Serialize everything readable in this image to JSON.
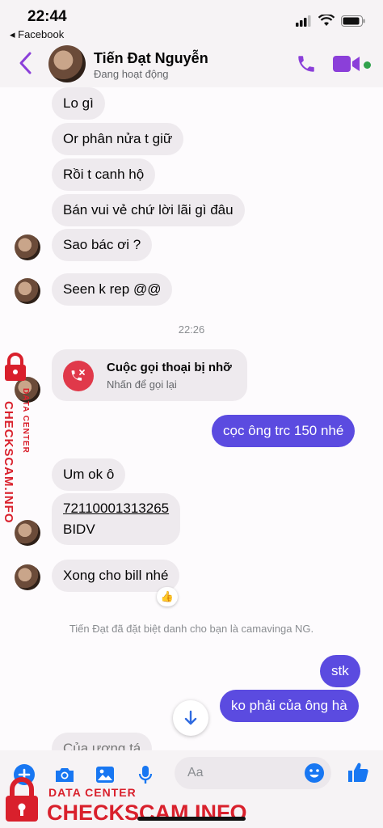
{
  "status_bar": {
    "time": "22:44",
    "back_app": "◂ Facebook"
  },
  "header": {
    "name": "Tiến Đạt Nguyễn",
    "status": "Đang hoạt động"
  },
  "messages_in_top": [
    "Lo gì",
    "Or phân nửa t giữ",
    "Rồi t canh hộ",
    "Bán vui vẻ chứ lời lãi gì đâu",
    "Sao bác ơi ?",
    "Seen k rep @@"
  ],
  "timestamp": "22:26",
  "missed_call": {
    "title": "Cuộc gọi thoại bị nhỡ",
    "subtitle": "Nhấn để gọi lại"
  },
  "message_out_1": "cọc ông trc 150 nhé",
  "message_in_ok": "Um ok ô",
  "account": {
    "number": "72110001313265",
    "bank": "BIDV"
  },
  "message_in_bill": "Xong cho bill nhé",
  "reaction": "👍",
  "system_note": "Tiến Đạt đã đặt biệt danh cho bạn là camavinga NG.",
  "messages_out_bottom": [
    "stk",
    "ko phải của ông hà"
  ],
  "partial_message": "Của ương tá",
  "composer": {
    "placeholder": "Aa"
  },
  "watermark": {
    "title": "CHECKSCAM.INFO",
    "subtitle": "DATA CENTER"
  },
  "colors": {
    "accent": "#5b4be0",
    "brand_purple": "#8b3fd9",
    "missed": "#e0394a",
    "online": "#31a24c",
    "watermark": "#d9202c"
  }
}
